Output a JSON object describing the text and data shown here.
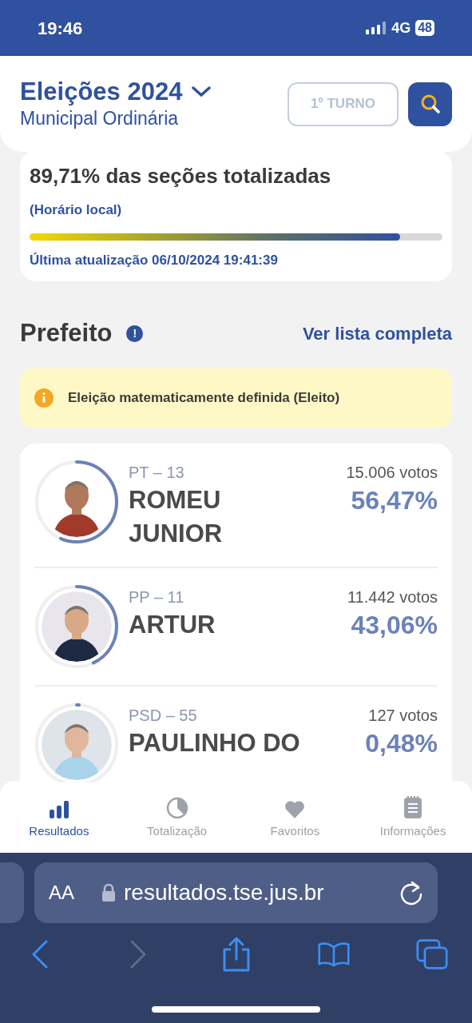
{
  "status_bar": {
    "time": "19:46",
    "network": "4G",
    "battery": "48"
  },
  "header": {
    "title": "Eleições 2024",
    "subtitle": "Municipal Ordinária",
    "round_button": "1º TURNO"
  },
  "progress": {
    "title": "89,71% das seções totalizadas",
    "note": "(Horário local)",
    "level": 0.8971,
    "updated": "Última atualização 06/10/2024 19:41:39"
  },
  "section": {
    "title": "Prefeito",
    "info_badge": "!",
    "link": "Ver lista completa"
  },
  "alert": {
    "text": "Eleição matematicamente definida (Eleito)"
  },
  "candidates": [
    {
      "party": "PT – 13",
      "name": "ROMEU JUNIOR",
      "votes": "15.006 votos",
      "percent": "56,47%",
      "level": 0.5647,
      "kind": "picture"
    },
    {
      "party": "PP – 11",
      "name": "ARTUR",
      "votes": "11.442 votos",
      "percent": "43,06%",
      "level": 0.4306,
      "kind": "picture"
    },
    {
      "party": "PSD – 55",
      "name": "PAULINHO DO",
      "votes": "127 votos",
      "percent": "0,48%",
      "level": 0.0048,
      "kind": "picture"
    }
  ],
  "tabs": [
    {
      "label": "Resultados",
      "kind": "bars",
      "selected": true
    },
    {
      "label": "Totalização",
      "kind": "pie",
      "selected": false
    },
    {
      "label": "Favoritos",
      "kind": "heart",
      "selected": false
    },
    {
      "label": "Informações",
      "kind": "notes",
      "selected": false
    }
  ],
  "browser": {
    "text_size_button": "AA",
    "url": "resultados.tse.jus.br",
    "back_enabled": true,
    "forward_enabled": false
  }
}
